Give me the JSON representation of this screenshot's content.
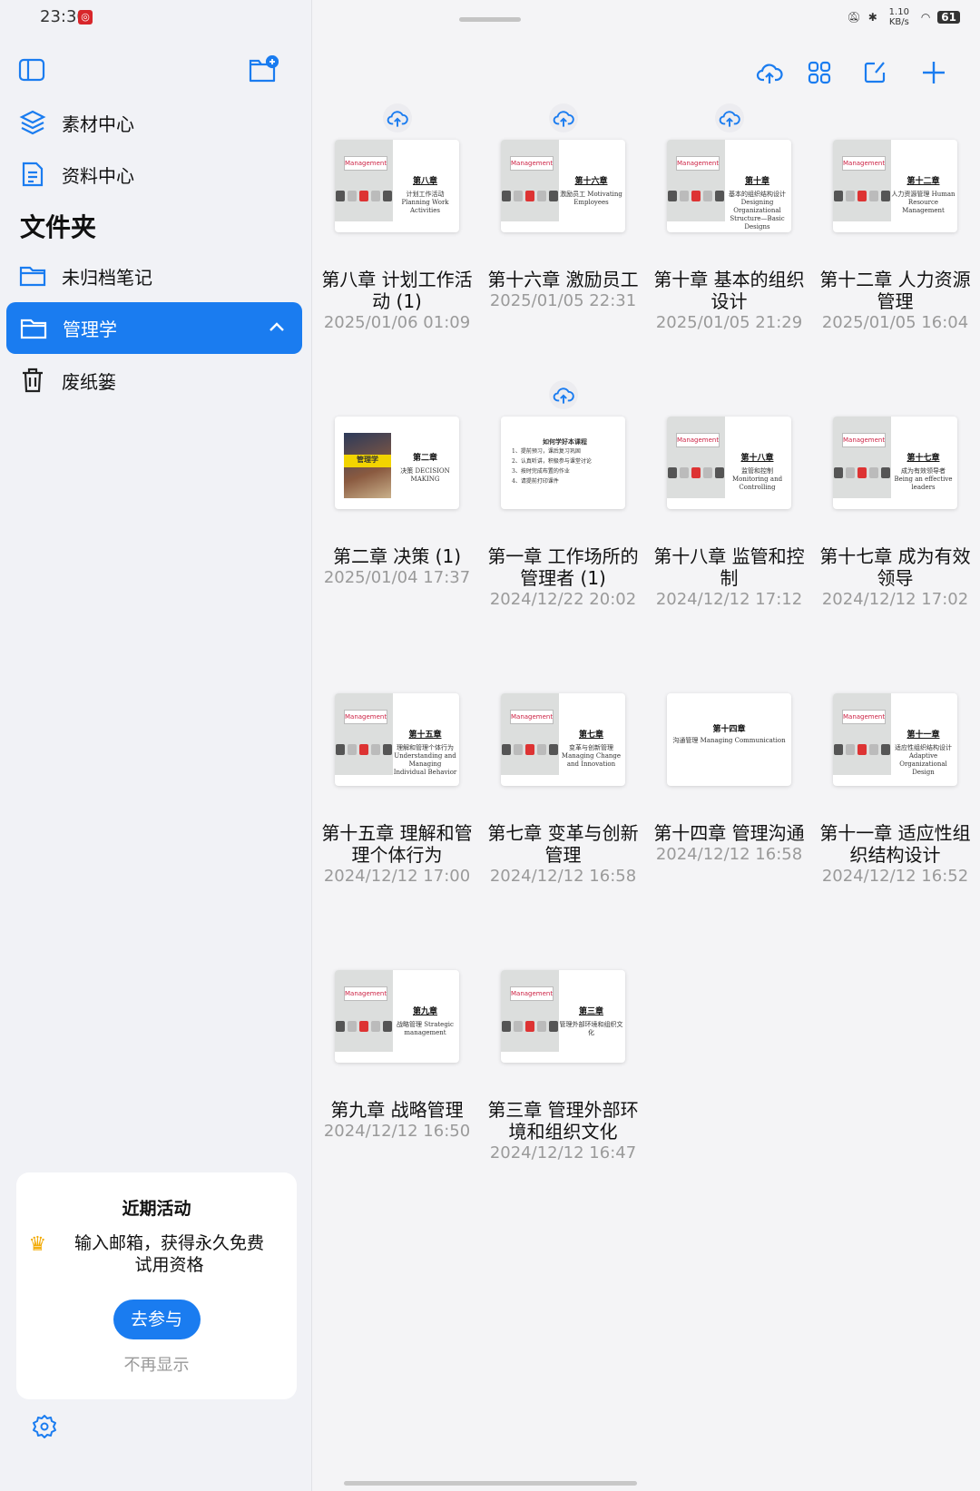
{
  "status": {
    "time": "23:30",
    "net": "1.10 KB/s",
    "battery": "61"
  },
  "sidebar": {
    "items": [
      {
        "label": "素材中心"
      },
      {
        "label": "资料中心"
      }
    ],
    "section_title": "文件夹",
    "folders": [
      {
        "label": "未归档笔记"
      },
      {
        "label": "管理学",
        "selected": true
      },
      {
        "label": "废纸篓"
      }
    ]
  },
  "promo": {
    "title": "近期活动",
    "text": "输入邮箱，获得永久免费试用资格",
    "button": "去参与",
    "dismiss": "不再显示"
  },
  "accent": "#1a7cf0",
  "notes": [
    {
      "title": "第八章 计划工作活动 (1)",
      "date": "2025/01/06 01:09",
      "cloud": true,
      "thumb": "mgmt",
      "tt": "第八章",
      "ts": "计划工作活动 Planning Work Activities"
    },
    {
      "title": "第十六章 激励员工",
      "date": "2025/01/05 22:31",
      "cloud": true,
      "thumb": "mgmt",
      "tt": "第十六章",
      "ts": "激励员工 Motivating Employees"
    },
    {
      "title": "第十章 基本的组织设计",
      "date": "2025/01/05 21:29",
      "cloud": true,
      "thumb": "mgmt",
      "tt": "第十章",
      "ts": "基本的组织结构设计 Designing Organizational Structure—Basic Designs"
    },
    {
      "title": "第十二章 人力资源管理",
      "date": "2025/01/05 16:04",
      "cloud": false,
      "thumb": "mgmt",
      "tt": "第十二章",
      "ts": "人力资源管理 Human Resource Management"
    },
    {
      "title": "第二章 决策 (1)",
      "date": "2025/01/04 17:37",
      "cloud": false,
      "thumb": "book",
      "tt": "第二章",
      "ts": "决策 DECISION MAKING",
      "book": "管理学"
    },
    {
      "title": "第一章 工作场所的管理者 (1)",
      "date": "2024/12/22 20:02",
      "cloud": true,
      "thumb": "list",
      "tt": "如何学好本课程",
      "lines": [
        "1、提前预习，课后复习巩固",
        "2、认真听讲，积极参与课堂讨论",
        "3、按时完成布置的作业",
        "4、请提前打印课件"
      ]
    },
    {
      "title": "第十八章 监管和控制",
      "date": "2024/12/12 17:12",
      "cloud": false,
      "thumb": "mgmt",
      "tt": "第十八章",
      "ts": "监管和控制 Monitoring and Controlling"
    },
    {
      "title": "第十七章 成为有效领导",
      "date": "2024/12/12 17:02",
      "cloud": false,
      "thumb": "mgmt",
      "tt": "第十七章",
      "ts": "成为有效领导者 Being an effective leaders"
    },
    {
      "title": "第十五章 理解和管理个体行为",
      "date": "2024/12/12 17:00",
      "cloud": false,
      "thumb": "mgmt",
      "tt": "第十五章",
      "ts": "理解和管理个体行为 Understanding and Managing Individual Behavior"
    },
    {
      "title": "第七章 变革与创新管理",
      "date": "2024/12/12 16:58",
      "cloud": false,
      "thumb": "mgmt",
      "tt": "第七章",
      "ts": "变革与创新管理 Managing Change and Innovation"
    },
    {
      "title": "第十四章 管理沟通",
      "date": "2024/12/12 16:58",
      "cloud": false,
      "thumb": "plain",
      "tt": "第十四章",
      "ts": "沟通管理 Managing Communication"
    },
    {
      "title": "第十一章 适应性组织结构设计",
      "date": "2024/12/12 16:52",
      "cloud": false,
      "thumb": "mgmt",
      "tt": "第十一章",
      "ts": "适应性组织结构设计 Adaptive Organizational Design"
    },
    {
      "title": "第九章 战略管理",
      "date": "2024/12/12 16:50",
      "cloud": false,
      "thumb": "mgmt",
      "tt": "第九章",
      "ts": "战略管理 Strategic management"
    },
    {
      "title": "第三章 管理外部环境和组织文化",
      "date": "2024/12/12 16:47",
      "cloud": false,
      "thumb": "mgmt",
      "tt": "第三章",
      "ts": "管理外部环境和组织文化"
    }
  ],
  "thumb_brand": "Management"
}
